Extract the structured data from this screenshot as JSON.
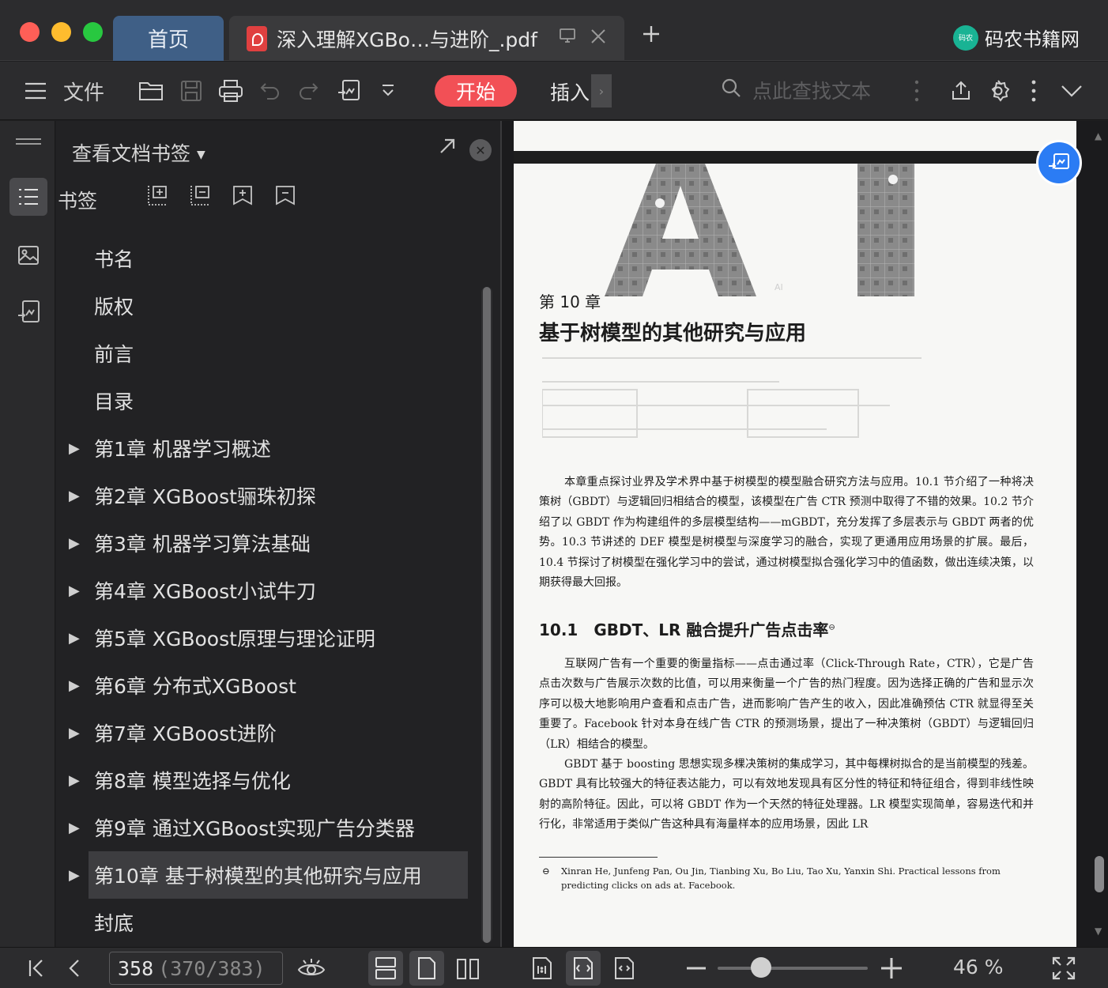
{
  "window": {
    "traffic_colors": {
      "close": "#fe5f57",
      "minimize": "#febc2e",
      "maximize": "#28c840"
    },
    "tabs": [
      {
        "label": "首页",
        "active": false
      },
      {
        "label": "深入理解XGBo…与进阶_.pdf",
        "active": true
      }
    ],
    "brand": {
      "name": "码农书籍网",
      "logo_text": "码农"
    }
  },
  "toolbar": {
    "file_label": "文件",
    "start_label": "开始",
    "insert_label": "插入",
    "search_placeholder": "点此查找文本",
    "accent_color": "#f25056"
  },
  "bookmarks": {
    "panel_title": "查看文档书签",
    "section_label": "书签",
    "items": [
      {
        "label": "书名",
        "expandable": false
      },
      {
        "label": "版权",
        "expandable": false
      },
      {
        "label": "前言",
        "expandable": false
      },
      {
        "label": "目录",
        "expandable": false
      },
      {
        "label": "第1章 机器学习概述",
        "expandable": true
      },
      {
        "label": "第2章 XGBoost骊珠初探",
        "expandable": true
      },
      {
        "label": "第3章 机器学习算法基础",
        "expandable": true
      },
      {
        "label": "第4章 XGBoost小试牛刀",
        "expandable": true
      },
      {
        "label": "第5章 XGBoost原理与理论证明",
        "expandable": true
      },
      {
        "label": "第6章 分布式XGBoost",
        "expandable": true
      },
      {
        "label": "第7章 XGBoost进阶",
        "expandable": true
      },
      {
        "label": "第8章 模型选择与优化",
        "expandable": true
      },
      {
        "label": "第9章 通过XGBoost实现广告分类器",
        "expandable": true
      },
      {
        "label": "第10章 基于树模型的其他研究与应用",
        "expandable": true,
        "selected": true
      },
      {
        "label": "封底",
        "expandable": false
      }
    ]
  },
  "document": {
    "hero_text": "AI",
    "chapter_no": "第 10 章",
    "chapter_title": "基于树模型的其他研究与应用",
    "intro": "本章重点探讨业界及学术界中基于树模型的模型融合研究方法与应用。10.1 节介绍了一种将决策树（GBDT）与逻辑回归相结合的模型，该模型在广告 CTR 预测中取得了不错的效果。10.2 节介绍了以 GBDT 作为构建组件的多层模型结构——mGBDT，充分发挥了多层表示与 GBDT 两者的优势。10.3 节讲述的 DEF 模型是树模型与深度学习的融合，实现了更通用应用场景的扩展。最后，10.4 节探讨了树模型在强化学习中的尝试，通过树模型拟合强化学习中的值函数，做出连续决策，以期获得最大回报。",
    "section_title": "10.1　GBDT、LR 融合提升广告点击率",
    "section_mark": "⊖",
    "para1": "互联网广告有一个重要的衡量指标——点击通过率（Click-Through Rate，CTR），它是广告点击次数与广告展示次数的比值，可以用来衡量一个广告的热门程度。因为选择正确的广告和显示次序可以极大地影响用户查看和点击广告，进而影响广告产生的收入，因此准确预估 CTR 就显得至关重要了。Facebook 针对本身在线广告 CTR 的预测场景，提出了一种决策树（GBDT）与逻辑回归（LR）相结合的模型。",
    "para2": "GBDT 基于 boosting 思想实现多棵决策树的集成学习，其中每棵树拟合的是当前模型的残差。GBDT 具有比较强大的特征表达能力，可以有效地发现具有区分性的特征和特征组合，得到非线性映射的高阶特征。因此，可以将 GBDT 作为一个天然的特征处理器。LR 模型实现简单，容易迭代和并行化，非常适用于类似广告这种具有海量样本的应用场景，因此 LR",
    "footnote_mark": "⊖",
    "footnote": "Xinran He, Junfeng Pan, Ou Jin, Tianbing Xu, Bo Liu, Tao Xu, Yanxin Shi. Practical lessons from predicting clicks on ads at. Facebook."
  },
  "status": {
    "current_page": "358",
    "page_info": "(370/383)",
    "zoom_label": "46 %",
    "zoom_fraction": 0.46
  }
}
